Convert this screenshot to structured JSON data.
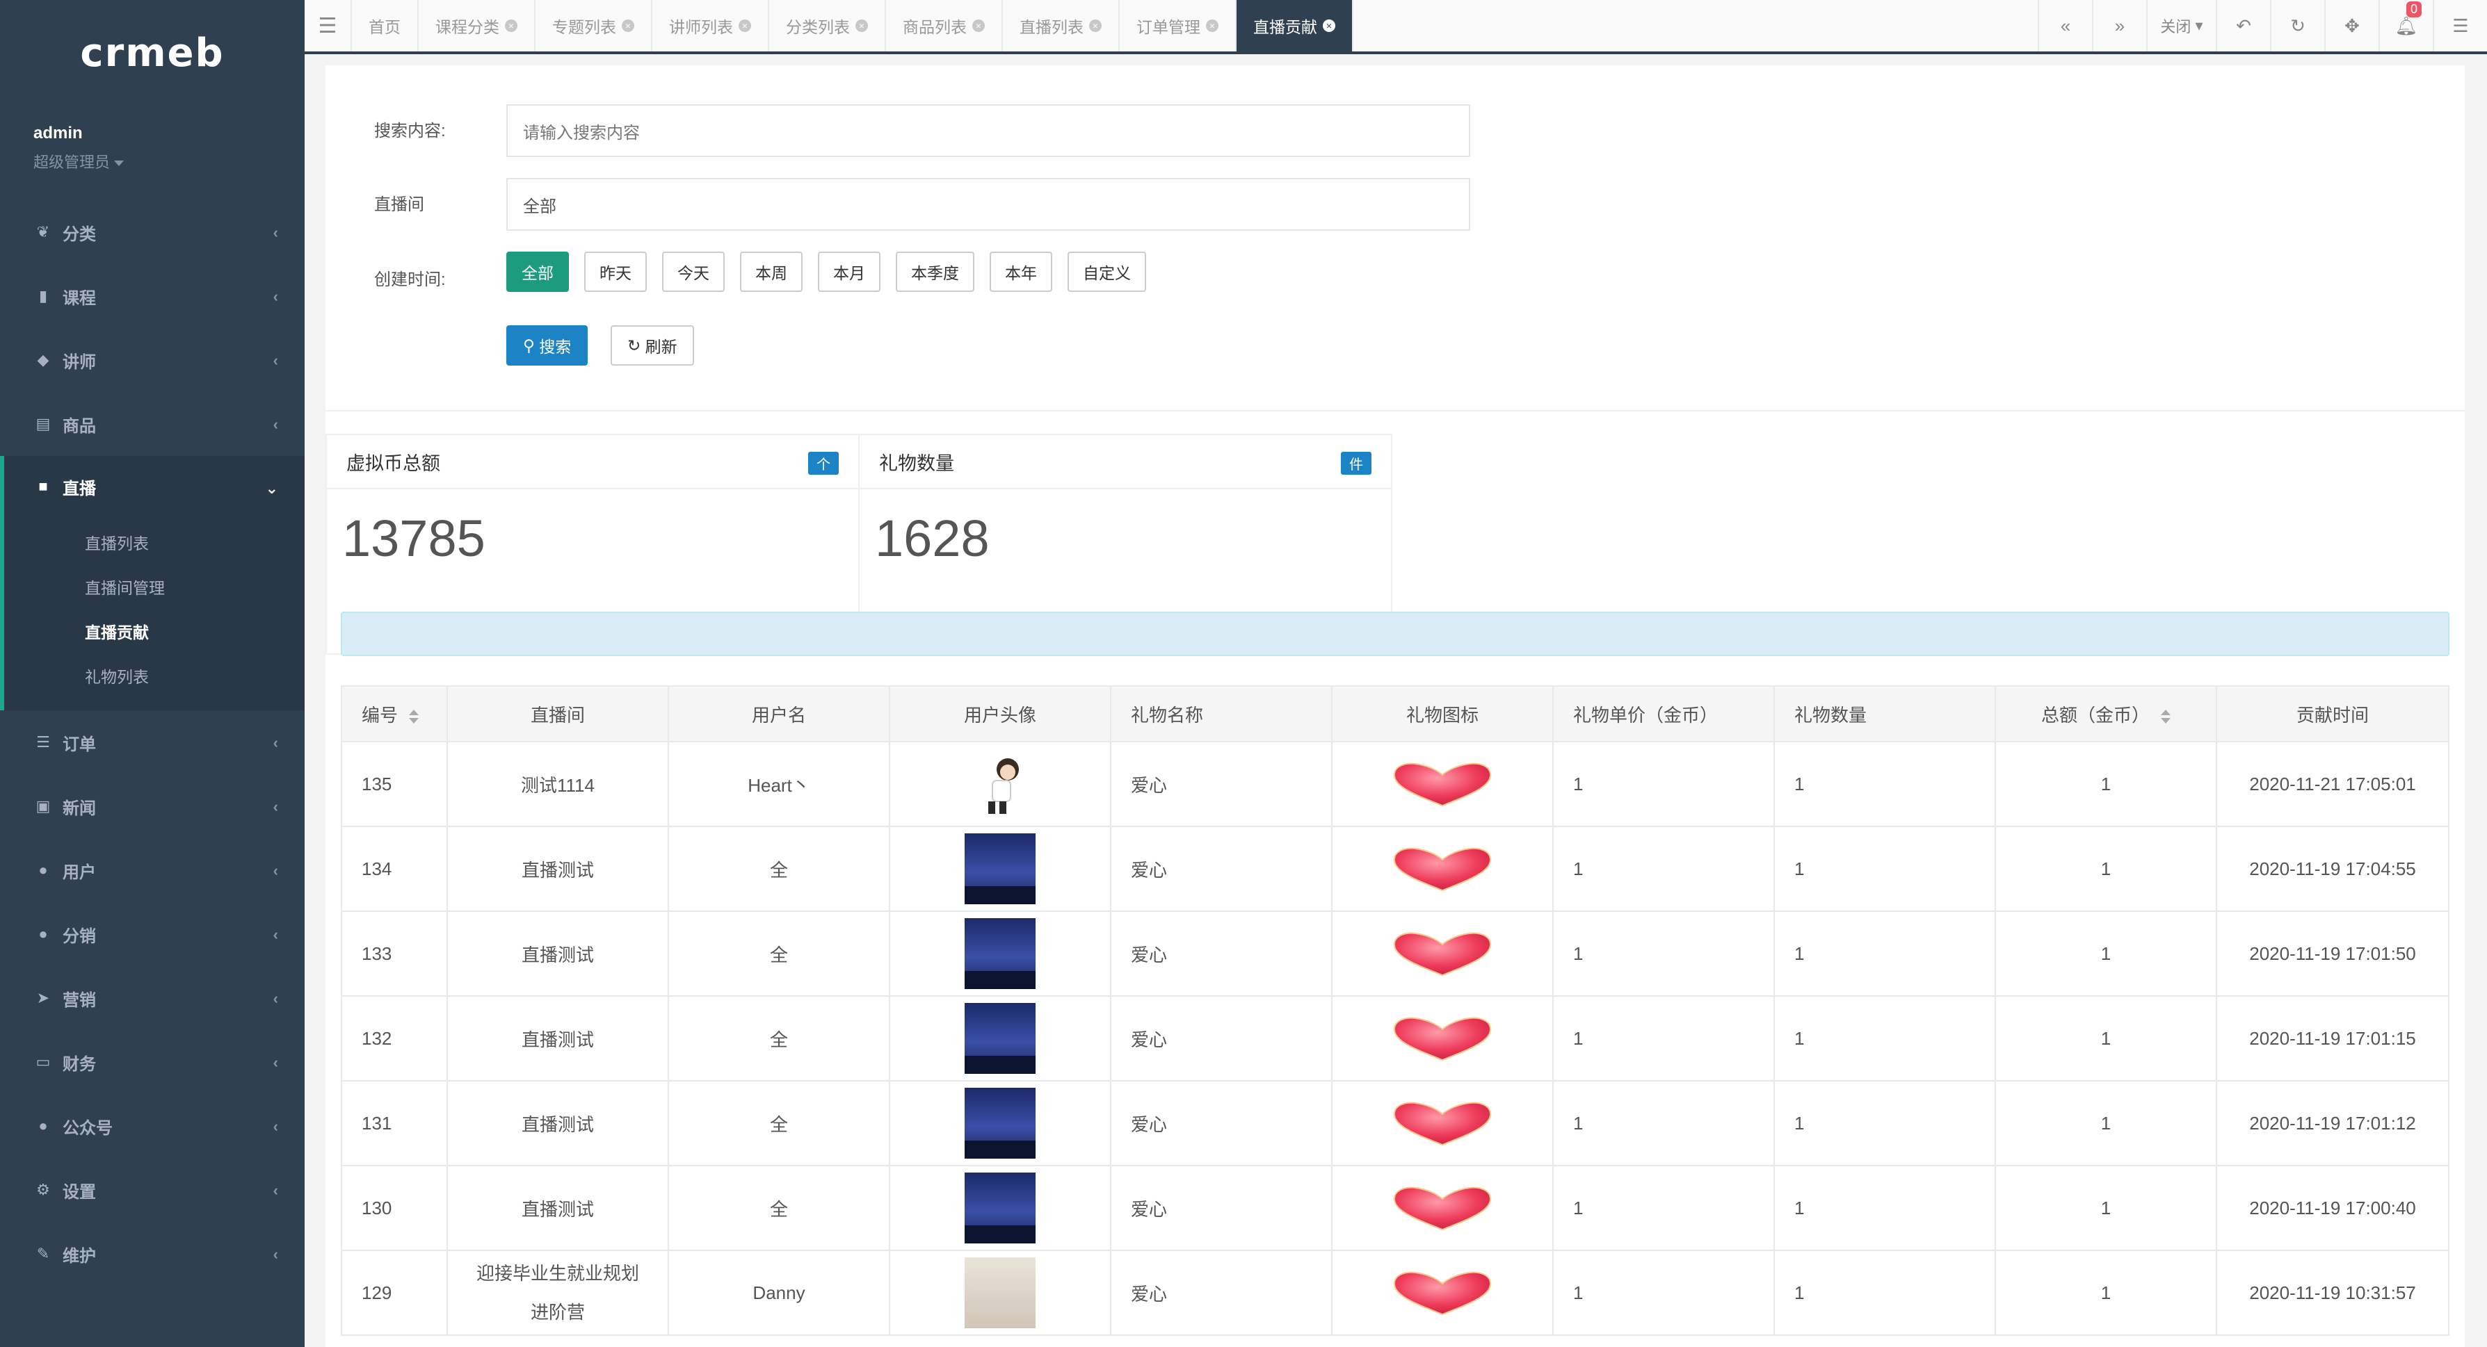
{
  "app": {
    "logo": "crmeb"
  },
  "profile": {
    "name": "admin",
    "role": "超级管理员"
  },
  "sidebar": {
    "items": [
      {
        "label": "分类",
        "icon": "leaf-icon"
      },
      {
        "label": "课程",
        "icon": "book-icon"
      },
      {
        "label": "讲师",
        "icon": "graduation-cap-icon"
      },
      {
        "label": "商品",
        "icon": "cart-icon"
      },
      {
        "label": "直播",
        "icon": "video-camera-icon"
      },
      {
        "label": "订单",
        "icon": "list-icon"
      },
      {
        "label": "新闻",
        "icon": "picture-icon"
      },
      {
        "label": "用户",
        "icon": "user-icon"
      },
      {
        "label": "分销",
        "icon": "users-icon"
      },
      {
        "label": "营销",
        "icon": "paper-plane-icon"
      },
      {
        "label": "财务",
        "icon": "money-icon"
      },
      {
        "label": "公众号",
        "icon": "wechat-icon"
      },
      {
        "label": "设置",
        "icon": "gear-icon"
      },
      {
        "label": "维护",
        "icon": "wrench-icon"
      }
    ],
    "live_sub": [
      "直播列表",
      "直播间管理",
      "直播贡献",
      "礼物列表"
    ]
  },
  "tabs": [
    "首页",
    "课程分类",
    "专题列表",
    "讲师列表",
    "分类列表",
    "商品列表",
    "直播列表",
    "订单管理",
    "直播贡献"
  ],
  "toolbar": {
    "close_label": "关闭",
    "notifications": "0"
  },
  "search": {
    "content_label": "搜索内容:",
    "content_placeholder": "请输入搜索内容",
    "room_label": "直播间",
    "room_value": "全部",
    "time_label": "创建时间:",
    "time_options": [
      "全部",
      "昨天",
      "今天",
      "本周",
      "本月",
      "本季度",
      "本年",
      "自定义"
    ],
    "search_btn": "搜索",
    "refresh_btn": "刷新"
  },
  "stats": [
    {
      "title": "虚拟币总额",
      "tag": "个",
      "value": "13785"
    },
    {
      "title": "礼物数量",
      "tag": "件",
      "value": "1628"
    }
  ],
  "table": {
    "headers": [
      "编号",
      "直播间",
      "用户名",
      "用户头像",
      "礼物名称",
      "礼物图标",
      "礼物单价（金币）",
      "礼物数量",
      "总额（金币）",
      "贡献时间"
    ],
    "rows": [
      {
        "id": "135",
        "room": "测试1114",
        "user": "Heart丶",
        "gift": "爱心",
        "price": "1",
        "qty": "1",
        "total": "1",
        "time": "2020-11-21 17:05:01",
        "avatar": "cartoon"
      },
      {
        "id": "134",
        "room": "直播测试",
        "user": "全",
        "gift": "爱心",
        "price": "1",
        "qty": "1",
        "total": "1",
        "time": "2020-11-19 17:04:55",
        "avatar": "night"
      },
      {
        "id": "133",
        "room": "直播测试",
        "user": "全",
        "gift": "爱心",
        "price": "1",
        "qty": "1",
        "total": "1",
        "time": "2020-11-19 17:01:50",
        "avatar": "night"
      },
      {
        "id": "132",
        "room": "直播测试",
        "user": "全",
        "gift": "爱心",
        "price": "1",
        "qty": "1",
        "total": "1",
        "time": "2020-11-19 17:01:15",
        "avatar": "night"
      },
      {
        "id": "131",
        "room": "直播测试",
        "user": "全",
        "gift": "爱心",
        "price": "1",
        "qty": "1",
        "total": "1",
        "time": "2020-11-19 17:01:12",
        "avatar": "night"
      },
      {
        "id": "130",
        "room": "直播测试",
        "user": "全",
        "gift": "爱心",
        "price": "1",
        "qty": "1",
        "total": "1",
        "time": "2020-11-19 17:00:40",
        "avatar": "night"
      },
      {
        "id": "129",
        "room": "迎接毕业生就业规划进阶营",
        "user": "Danny",
        "gift": "爱心",
        "price": "1",
        "qty": "1",
        "total": "1",
        "time": "2020-11-19 10:31:57",
        "avatar": "office"
      }
    ]
  },
  "colors": {
    "sidebar": "#2f4050",
    "accent": "#19aa8d",
    "primary": "#1c84c6",
    "active_btn": "#1c9c7d"
  }
}
